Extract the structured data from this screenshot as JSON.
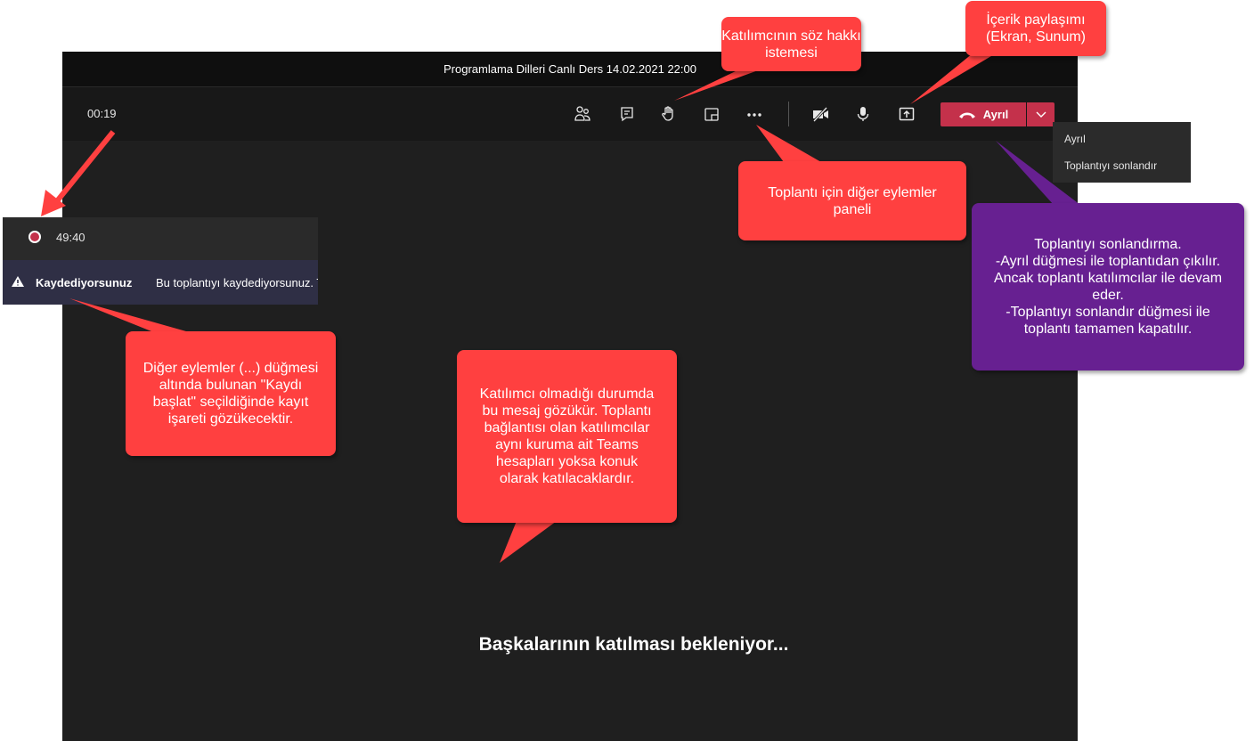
{
  "window": {
    "title": "Programlama Dilleri Canlı Ders 14.02.2021 22:00"
  },
  "controls": {
    "timer": "00:19",
    "participants_icon": "people-icon",
    "chat_icon": "chat-icon",
    "raise_hand_icon": "raise-hand-icon",
    "rooms_icon": "breakout-rooms-icon",
    "more_icon": "more-actions-icon",
    "camera_icon": "camera-off-icon",
    "mic_icon": "microphone-icon",
    "share_icon": "share-screen-icon",
    "leave_label": "Ayrıl"
  },
  "leave_menu": {
    "items": [
      "Ayrıl",
      "Toplantıyı sonlandır"
    ]
  },
  "recording": {
    "time": "49:40",
    "banner_bold": "Kaydediyorsunuz",
    "banner_text": "Bu toplantıyı kaydediyorsunuz. T"
  },
  "waiting_message": "Başkalarının katılması bekleniyor...",
  "callouts": {
    "raise_hand": "Katılımcının söz hakkı istemesi",
    "share": "İçerik paylaşımı (Ekran, Sunum)",
    "more_actions": "Toplantı için diğer eylemler paneli",
    "end_meeting": "Toplantıyı sonlandırma.\n-Ayrıl düğmesi ile toplantıdan çıkılır. Ancak toplantı katılımcılar ile devam eder.\n-Toplantıyı sonlandır düğmesi ile toplantı tamamen kapatılır.",
    "recording": "Diğer eylemler (...) düğmesi altında bulunan \"Kaydı başlat\" seçildiğinde kayıt işareti gözükecektir.",
    "no_participants": "Katılımcı olmadığı durumda bu mesaj gözükür. Toplantı bağlantısı olan katılımcılar aynı kuruma ait Teams hesapları yoksa konuk olarak katılacaklardır."
  },
  "colors": {
    "callout_red": "#ff4040",
    "callout_purple": "#672091",
    "leave_red": "#c4314b"
  }
}
